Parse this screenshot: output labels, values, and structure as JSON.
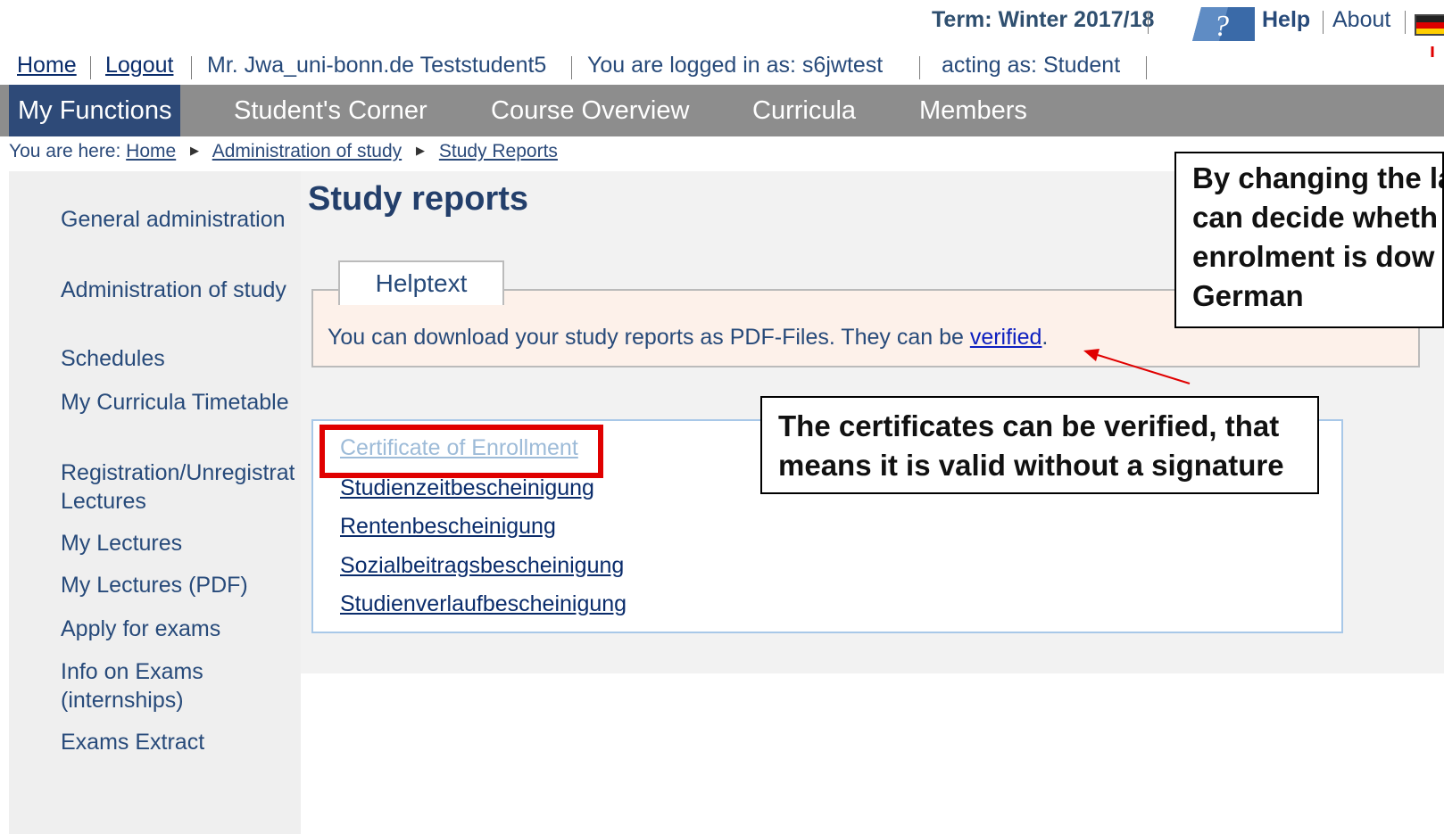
{
  "term_bar": {
    "term": "Term: Winter 2017/18",
    "help": "Help",
    "about": "About",
    "help_icon": "question-mark-icon",
    "flag_icon": "german-flag-icon"
  },
  "user_line": {
    "home": "Home",
    "logout": "Logout",
    "user_name": "Mr. Jwa_uni-bonn.de Teststudent5",
    "logged_in": "You are logged in as: s6jwtest",
    "acting_as": "acting as: Student"
  },
  "nav": {
    "tabs": [
      {
        "label": "My Functions"
      },
      {
        "label": "Student's Corner"
      },
      {
        "label": "Course Overview"
      },
      {
        "label": "Curricula"
      },
      {
        "label": "Members"
      }
    ]
  },
  "breadcrumb": {
    "prefix": "You are here:",
    "items": [
      "Home",
      "Administration of study",
      "Study Reports"
    ]
  },
  "sidebar": {
    "items": [
      {
        "label": "General administration"
      },
      {
        "label": "Administration of study"
      },
      {
        "label": "Schedules"
      },
      {
        "label": "My Curricula Timetable"
      },
      {
        "label": "Registration/Unregistration of Lectures"
      },
      {
        "label": "My Lectures"
      },
      {
        "label": "My Lectures (PDF)"
      },
      {
        "label": "Apply for exams"
      },
      {
        "label": "Info on Exams (internships)"
      },
      {
        "label": "Exams Extract"
      }
    ]
  },
  "main": {
    "title": "Study reports",
    "helptext_tab": "Helptext",
    "helptext_before": "You can download your study reports as PDF-Files. They can be ",
    "helptext_link": "verified",
    "helptext_after": ".",
    "reports": [
      "Certificate of Enrollment",
      "Studienzeitbescheinigung",
      "Rentenbescheinigung",
      "Sozialbeitragsbescheinigung",
      "Studienverlaufbescheinigung"
    ]
  },
  "callouts": {
    "verify_line1": "The certificates can be verified, that",
    "verify_line2": "means it is valid without a signature",
    "lang_line1": "By changing the la",
    "lang_line2": "can decide wheth",
    "lang_line3": "enrolment is dow",
    "lang_line4": "German"
  },
  "colors": {
    "nav_bg": "#8d8d8d",
    "nav_active": "#2e4a78",
    "highlight_red": "#e00000",
    "helpbox_bg": "#fdf1ea"
  }
}
